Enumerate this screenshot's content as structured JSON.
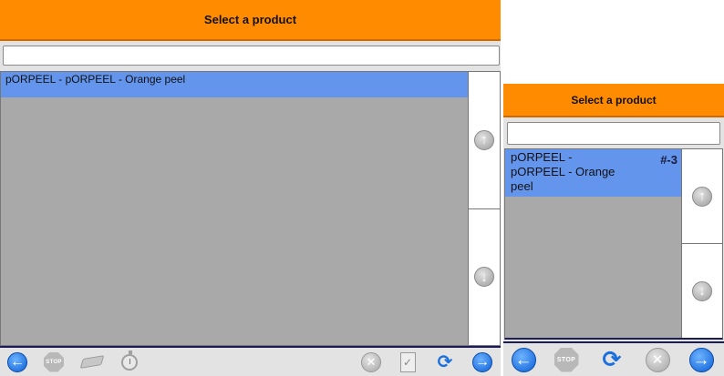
{
  "panels": [
    {
      "header": {
        "title": "Select a product"
      },
      "search": {
        "value": ""
      },
      "list": {
        "items": [
          {
            "label": "pORPEEL - pORPEEL - Orange peel",
            "badge": ""
          }
        ]
      },
      "scroller": {
        "up_icon": "arrow-up-icon",
        "down_icon": "arrow-down-icon"
      },
      "toolbar": {
        "buttons": [
          "back",
          "stop",
          "eraser",
          "timer",
          "cancel",
          "checklist",
          "refresh",
          "next"
        ]
      }
    },
    {
      "header": {
        "title": "Select a product"
      },
      "search": {
        "value": ""
      },
      "list": {
        "items": [
          {
            "label": "pORPEEL - pORPEEL - Orange peel",
            "badge": "#-3"
          }
        ]
      },
      "scroller": {
        "up_icon": "arrow-up-icon",
        "down_icon": "arrow-down-icon"
      },
      "toolbar": {
        "buttons": [
          "back",
          "stop",
          "refresh",
          "cancel",
          "next"
        ]
      }
    }
  ],
  "icons": {
    "stop_text": "STOP",
    "back_glyph": "←",
    "next_glyph": "→",
    "up_glyph": "↑",
    "down_glyph": "↓",
    "cancel_glyph": "✕",
    "check_glyph": "✓",
    "refresh_glyph": "⟳"
  },
  "colors": {
    "header": "#ff8c00",
    "selected_row": "#6495ed",
    "list_background": "#a9a9a9",
    "panel_background": "#e3e3e3",
    "toolbar_border": "#1c1c55",
    "blue_button": "#0b5fd6"
  }
}
